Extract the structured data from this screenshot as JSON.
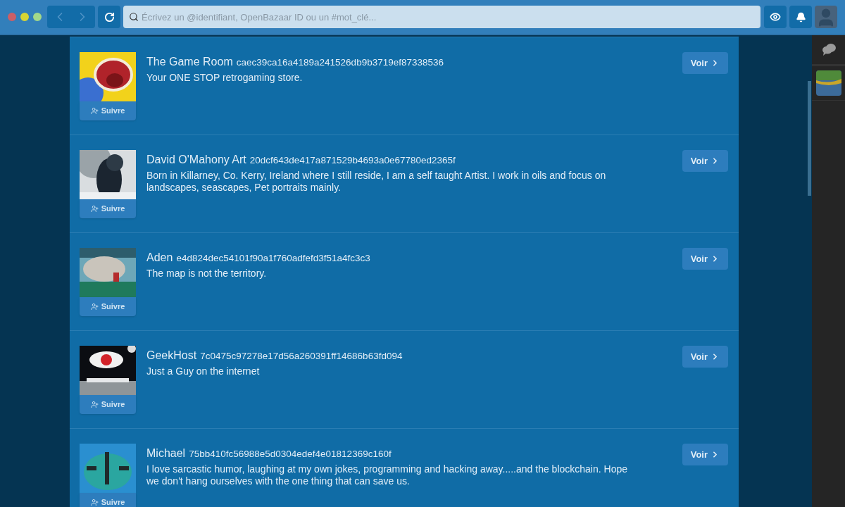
{
  "search": {
    "placeholder": "Écrivez un @identifiant, OpenBazaar ID ou un #mot_clé..."
  },
  "stores": [
    {
      "name": "The Game Room",
      "id": "caec39ca16a4189a241526db9b3719ef87338536",
      "description": "Your ONE STOP retrogaming store.",
      "follow": "Suivre",
      "view": "Voir"
    },
    {
      "name": "David O'Mahony Art",
      "id": "20dcf643de417a871529b4693a0e67780ed2365f",
      "description": "Born in Killarney, Co. Kerry, Ireland where I still reside, I am a self taught Artist. I work in oils and focus on landscapes, seascapes, Pet portraits mainly.",
      "follow": "Suivre",
      "view": "Voir"
    },
    {
      "name": "Aden",
      "id": "e4d824dec54101f90a1f760adfefd3f51a4fc3c3",
      "description": "The map is not the territory.",
      "follow": "Suivre",
      "view": "Voir"
    },
    {
      "name": "GeekHost",
      "id": "7c0475c97278e17d56a260391ff14686b63fd094",
      "description": "Just a Guy on the internet",
      "follow": "Suivre",
      "view": "Voir"
    },
    {
      "name": "Michael",
      "id": "75bb410fc56988e5d0304edef4e01812369c160f",
      "description": "I love sarcastic humor, laughing at my own jokes, programming and hacking away.....and the blockchain. Hope we don't hang ourselves with the one thing that can save us.",
      "follow": "Suivre",
      "view": "Voir"
    }
  ]
}
